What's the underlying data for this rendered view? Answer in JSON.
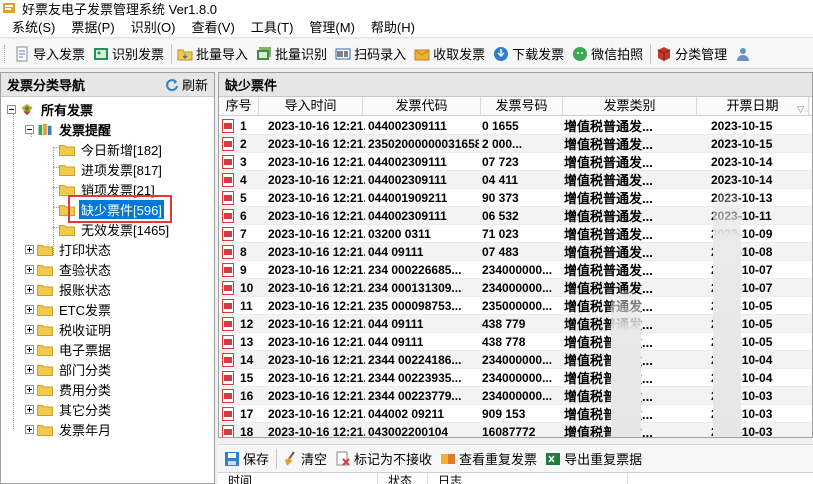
{
  "window": {
    "title": "好票友电子发票管理系统 Ver1.8.0"
  },
  "menu": [
    "系统(S)",
    "票据(P)",
    "识别(O)",
    "查看(V)",
    "工具(T)",
    "管理(M)",
    "帮助(H)"
  ],
  "toolbar": {
    "import": "导入发票",
    "recognize": "识别发票",
    "batch_import": "批量导入",
    "batch_recognize": "批量识别",
    "scan": "扫码录入",
    "receive": "收取发票",
    "download": "下载发票",
    "wechat": "微信拍照",
    "classify": "分类管理"
  },
  "nav": {
    "title": "发票分类导航",
    "refresh": "刷新",
    "root": "所有发票",
    "reminder": "发票提醒",
    "children": [
      "今日新增[182]",
      "进项发票[817]",
      "销项发票[21]",
      "缺少票件[596]",
      "无效发票[1465]"
    ],
    "groups": [
      "打印状态",
      "查验状态",
      "报账状态",
      "ETC发票",
      "税收证明",
      "电子票据",
      "部门分类",
      "费用分类",
      "其它分类",
      "发票年月"
    ]
  },
  "grid": {
    "title": "缺少票件",
    "columns": [
      "序号",
      "导入时间",
      "发票代码",
      "发票号码",
      "发票类别",
      "开票日期"
    ],
    "rows": [
      [
        "1",
        "2023-10-16 12:21...",
        "044002309111",
        "0  1655",
        "增值税普通发...",
        "2023-10-15"
      ],
      [
        "2",
        "2023-10-16 12:21...",
        "23502000000031658...",
        "2  000...",
        "增值税普通发...",
        "2023-10-15"
      ],
      [
        "3",
        "2023-10-16 12:21...",
        "044002309111",
        "07  723",
        "增值税普通发...",
        "2023-10-14"
      ],
      [
        "4",
        "2023-10-16 12:21...",
        "044002309111",
        "04  411",
        "增值税普通发...",
        "2023-10-14"
      ],
      [
        "5",
        "2023-10-16 12:21...",
        "044001909211",
        "90  373",
        "增值税普通发...",
        "2023-10-13"
      ],
      [
        "6",
        "2023-10-16 12:21...",
        "044002309111",
        "06  532",
        "增值税普通发...",
        "2023-10-11"
      ],
      [
        "7",
        "2023-10-16 12:21...",
        "03200   0311",
        "71  023",
        "增值税普通发...",
        "2023-10-09"
      ],
      [
        "8",
        "2023-10-16 12:21...",
        "044   09111",
        "07  483",
        "增值税普通发...",
        "2023-10-08"
      ],
      [
        "9",
        "2023-10-16 12:21...",
        "234   000226685...",
        "234000000...",
        "增值税普通发...",
        "2023-10-07"
      ],
      [
        "10",
        "2023-10-16 12:21...",
        "234   000131309...",
        "234000000...",
        "增值税普通发...",
        "2023-10-07"
      ],
      [
        "11",
        "2023-10-16 12:21...",
        "235   000098753...",
        "235000000...",
        "增值税普通发...",
        "2023-10-05"
      ],
      [
        "12",
        "2023-10-16 12:21...",
        "044   09111",
        "438  779",
        "增值税普通发...",
        "2023-10-05"
      ],
      [
        "13",
        "2023-10-16 12:21...",
        "044   09111",
        "438  778",
        "增值税普通发...",
        "2023-10-05"
      ],
      [
        "14",
        "2023-10-16 12:21...",
        "2344   00224186...",
        "234000000...",
        "增值税普通发...",
        "2023-10-04"
      ],
      [
        "15",
        "2023-10-16 12:21...",
        "2344   00223935...",
        "234000000...",
        "增值税普通发...",
        "2023-10-04"
      ],
      [
        "16",
        "2023-10-16 12:21...",
        "2344   00223779...",
        "234000000...",
        "增值税普通发...",
        "2023-10-03"
      ],
      [
        "17",
        "2023-10-16 12:21...",
        "044002   09211",
        "909  153",
        "增值税普通发...",
        "2023-10-03"
      ],
      [
        "18",
        "2023-10-16 12:21...",
        "043002200104",
        "16087772",
        "增值税普通发...",
        "2023-10-03"
      ]
    ]
  },
  "bottom": {
    "save": "保存",
    "clear": "清空",
    "mark": "标记为不接收",
    "view_dup": "查看重复发票",
    "export_dup": "导出重复票据",
    "columns": [
      "时间",
      "状态",
      "日志"
    ]
  },
  "colors": {
    "selected": "#0078d7",
    "highlight_box": "#e53935",
    "folder": "#f2c94c",
    "pdf": "#d63b3b"
  }
}
